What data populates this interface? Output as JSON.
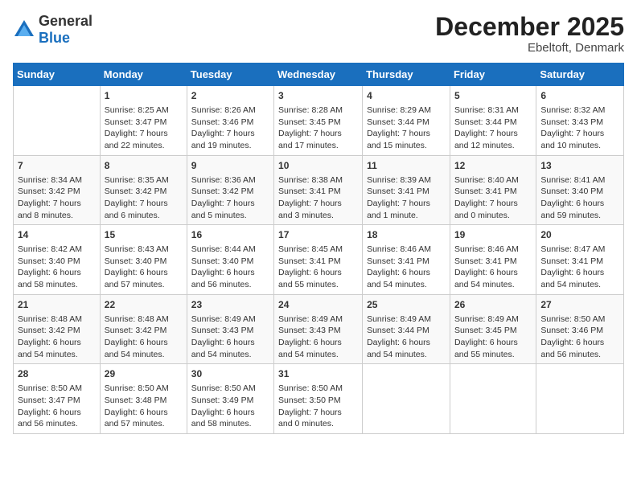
{
  "logo": {
    "general": "General",
    "blue": "Blue"
  },
  "header": {
    "title": "December 2025",
    "subtitle": "Ebeltoft, Denmark"
  },
  "calendar": {
    "days_of_week": [
      "Sunday",
      "Monday",
      "Tuesday",
      "Wednesday",
      "Thursday",
      "Friday",
      "Saturday"
    ],
    "weeks": [
      [
        {
          "day": null,
          "content": null
        },
        {
          "day": "1",
          "content": "Sunrise: 8:25 AM\nSunset: 3:47 PM\nDaylight: 7 hours\nand 22 minutes."
        },
        {
          "day": "2",
          "content": "Sunrise: 8:26 AM\nSunset: 3:46 PM\nDaylight: 7 hours\nand 19 minutes."
        },
        {
          "day": "3",
          "content": "Sunrise: 8:28 AM\nSunset: 3:45 PM\nDaylight: 7 hours\nand 17 minutes."
        },
        {
          "day": "4",
          "content": "Sunrise: 8:29 AM\nSunset: 3:44 PM\nDaylight: 7 hours\nand 15 minutes."
        },
        {
          "day": "5",
          "content": "Sunrise: 8:31 AM\nSunset: 3:44 PM\nDaylight: 7 hours\nand 12 minutes."
        },
        {
          "day": "6",
          "content": "Sunrise: 8:32 AM\nSunset: 3:43 PM\nDaylight: 7 hours\nand 10 minutes."
        }
      ],
      [
        {
          "day": "7",
          "content": "Sunrise: 8:34 AM\nSunset: 3:42 PM\nDaylight: 7 hours\nand 8 minutes."
        },
        {
          "day": "8",
          "content": "Sunrise: 8:35 AM\nSunset: 3:42 PM\nDaylight: 7 hours\nand 6 minutes."
        },
        {
          "day": "9",
          "content": "Sunrise: 8:36 AM\nSunset: 3:42 PM\nDaylight: 7 hours\nand 5 minutes."
        },
        {
          "day": "10",
          "content": "Sunrise: 8:38 AM\nSunset: 3:41 PM\nDaylight: 7 hours\nand 3 minutes."
        },
        {
          "day": "11",
          "content": "Sunrise: 8:39 AM\nSunset: 3:41 PM\nDaylight: 7 hours\nand 1 minute."
        },
        {
          "day": "12",
          "content": "Sunrise: 8:40 AM\nSunset: 3:41 PM\nDaylight: 7 hours\nand 0 minutes."
        },
        {
          "day": "13",
          "content": "Sunrise: 8:41 AM\nSunset: 3:40 PM\nDaylight: 6 hours\nand 59 minutes."
        }
      ],
      [
        {
          "day": "14",
          "content": "Sunrise: 8:42 AM\nSunset: 3:40 PM\nDaylight: 6 hours\nand 58 minutes."
        },
        {
          "day": "15",
          "content": "Sunrise: 8:43 AM\nSunset: 3:40 PM\nDaylight: 6 hours\nand 57 minutes."
        },
        {
          "day": "16",
          "content": "Sunrise: 8:44 AM\nSunset: 3:40 PM\nDaylight: 6 hours\nand 56 minutes."
        },
        {
          "day": "17",
          "content": "Sunrise: 8:45 AM\nSunset: 3:41 PM\nDaylight: 6 hours\nand 55 minutes."
        },
        {
          "day": "18",
          "content": "Sunrise: 8:46 AM\nSunset: 3:41 PM\nDaylight: 6 hours\nand 54 minutes."
        },
        {
          "day": "19",
          "content": "Sunrise: 8:46 AM\nSunset: 3:41 PM\nDaylight: 6 hours\nand 54 minutes."
        },
        {
          "day": "20",
          "content": "Sunrise: 8:47 AM\nSunset: 3:41 PM\nDaylight: 6 hours\nand 54 minutes."
        }
      ],
      [
        {
          "day": "21",
          "content": "Sunrise: 8:48 AM\nSunset: 3:42 PM\nDaylight: 6 hours\nand 54 minutes."
        },
        {
          "day": "22",
          "content": "Sunrise: 8:48 AM\nSunset: 3:42 PM\nDaylight: 6 hours\nand 54 minutes."
        },
        {
          "day": "23",
          "content": "Sunrise: 8:49 AM\nSunset: 3:43 PM\nDaylight: 6 hours\nand 54 minutes."
        },
        {
          "day": "24",
          "content": "Sunrise: 8:49 AM\nSunset: 3:43 PM\nDaylight: 6 hours\nand 54 minutes."
        },
        {
          "day": "25",
          "content": "Sunrise: 8:49 AM\nSunset: 3:44 PM\nDaylight: 6 hours\nand 54 minutes."
        },
        {
          "day": "26",
          "content": "Sunrise: 8:49 AM\nSunset: 3:45 PM\nDaylight: 6 hours\nand 55 minutes."
        },
        {
          "day": "27",
          "content": "Sunrise: 8:50 AM\nSunset: 3:46 PM\nDaylight: 6 hours\nand 56 minutes."
        }
      ],
      [
        {
          "day": "28",
          "content": "Sunrise: 8:50 AM\nSunset: 3:47 PM\nDaylight: 6 hours\nand 56 minutes."
        },
        {
          "day": "29",
          "content": "Sunrise: 8:50 AM\nSunset: 3:48 PM\nDaylight: 6 hours\nand 57 minutes."
        },
        {
          "day": "30",
          "content": "Sunrise: 8:50 AM\nSunset: 3:49 PM\nDaylight: 6 hours\nand 58 minutes."
        },
        {
          "day": "31",
          "content": "Sunrise: 8:50 AM\nSunset: 3:50 PM\nDaylight: 7 hours\nand 0 minutes."
        },
        {
          "day": null,
          "content": null
        },
        {
          "day": null,
          "content": null
        },
        {
          "day": null,
          "content": null
        }
      ]
    ]
  }
}
